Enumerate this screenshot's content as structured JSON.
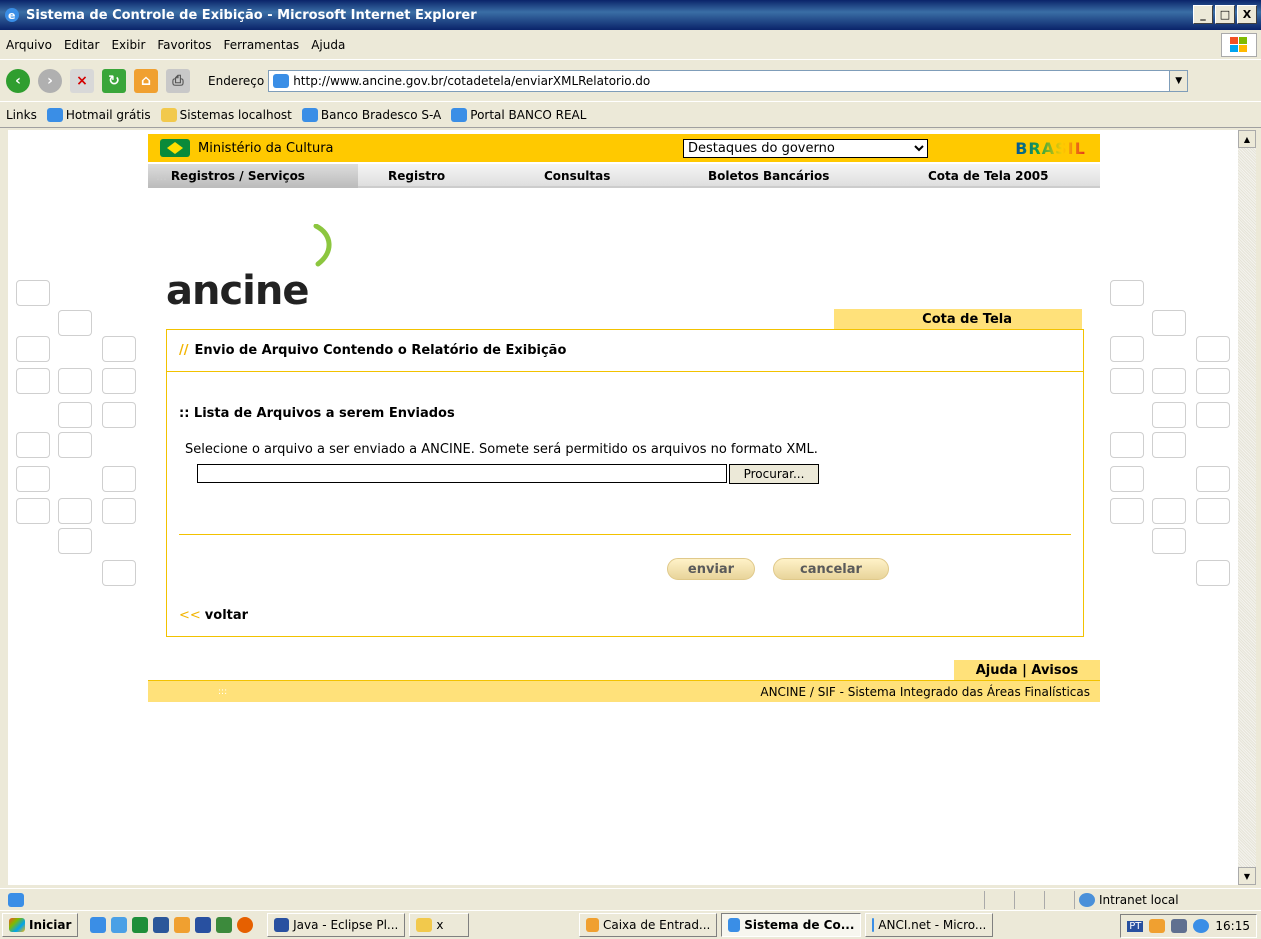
{
  "window": {
    "title": "Sistema de Controle de Exibição - Microsoft Internet Explorer",
    "controls": [
      "_",
      "□",
      "X"
    ]
  },
  "menu": [
    "Arquivo",
    "Editar",
    "Exibir",
    "Favoritos",
    "Ferramentas",
    "Ajuda"
  ],
  "toolbar": {
    "address_label": "Endereço",
    "address_value": "http://www.ancine.gov.br/cotadetela/enviarXMLRelatorio.do"
  },
  "links": {
    "label": "Links",
    "items": [
      "Hotmail grátis",
      "Sistemas localhost",
      "Banco Bradesco S-A",
      "Portal BANCO REAL"
    ]
  },
  "gov": {
    "ministry": "Ministério da Cultura",
    "dropdown_selected": "Destaques do governo",
    "brand": "BRASIL"
  },
  "nav": {
    "items": [
      "Registros / Serviços",
      "Registro",
      "Consultas",
      "Boletos Bancários",
      "Cota de Tela 2005"
    ]
  },
  "logo": {
    "text": "ancine"
  },
  "panel": {
    "tab": "Cota de Tela",
    "slashes": "//",
    "title": "Envio de Arquivo Contendo o Relatório de Exibição",
    "section_title": ":: Lista de Arquivos a serem Enviados",
    "instruction": "Selecione o arquivo a ser enviado a ANCINE. Somete será permitido os arquivos no formato XML.",
    "file_value": "",
    "browse_label": "Procurar...",
    "send_label": "enviar",
    "cancel_label": "cancelar",
    "back_arrows": "<<",
    "back_label": "voltar"
  },
  "footer": {
    "help_links": "Ajuda | Avisos",
    "dots": ":::",
    "system_text": "ANCINE / SIF - Sistema Integrado das Áreas Finalísticas"
  },
  "status": {
    "zone": "Intranet local"
  },
  "taskbar": {
    "start": "Iniciar",
    "tasks": [
      "Java - Eclipse Pl...",
      "x",
      "Caixa de Entrad...",
      "Sistema de Co...",
      "ANCI.net - Micro..."
    ],
    "lang": "PT",
    "clock": "16:15"
  },
  "colors": {
    "gold": "#ffc900",
    "panel_border": "#f2c200",
    "title_blue": "#0a246a"
  }
}
